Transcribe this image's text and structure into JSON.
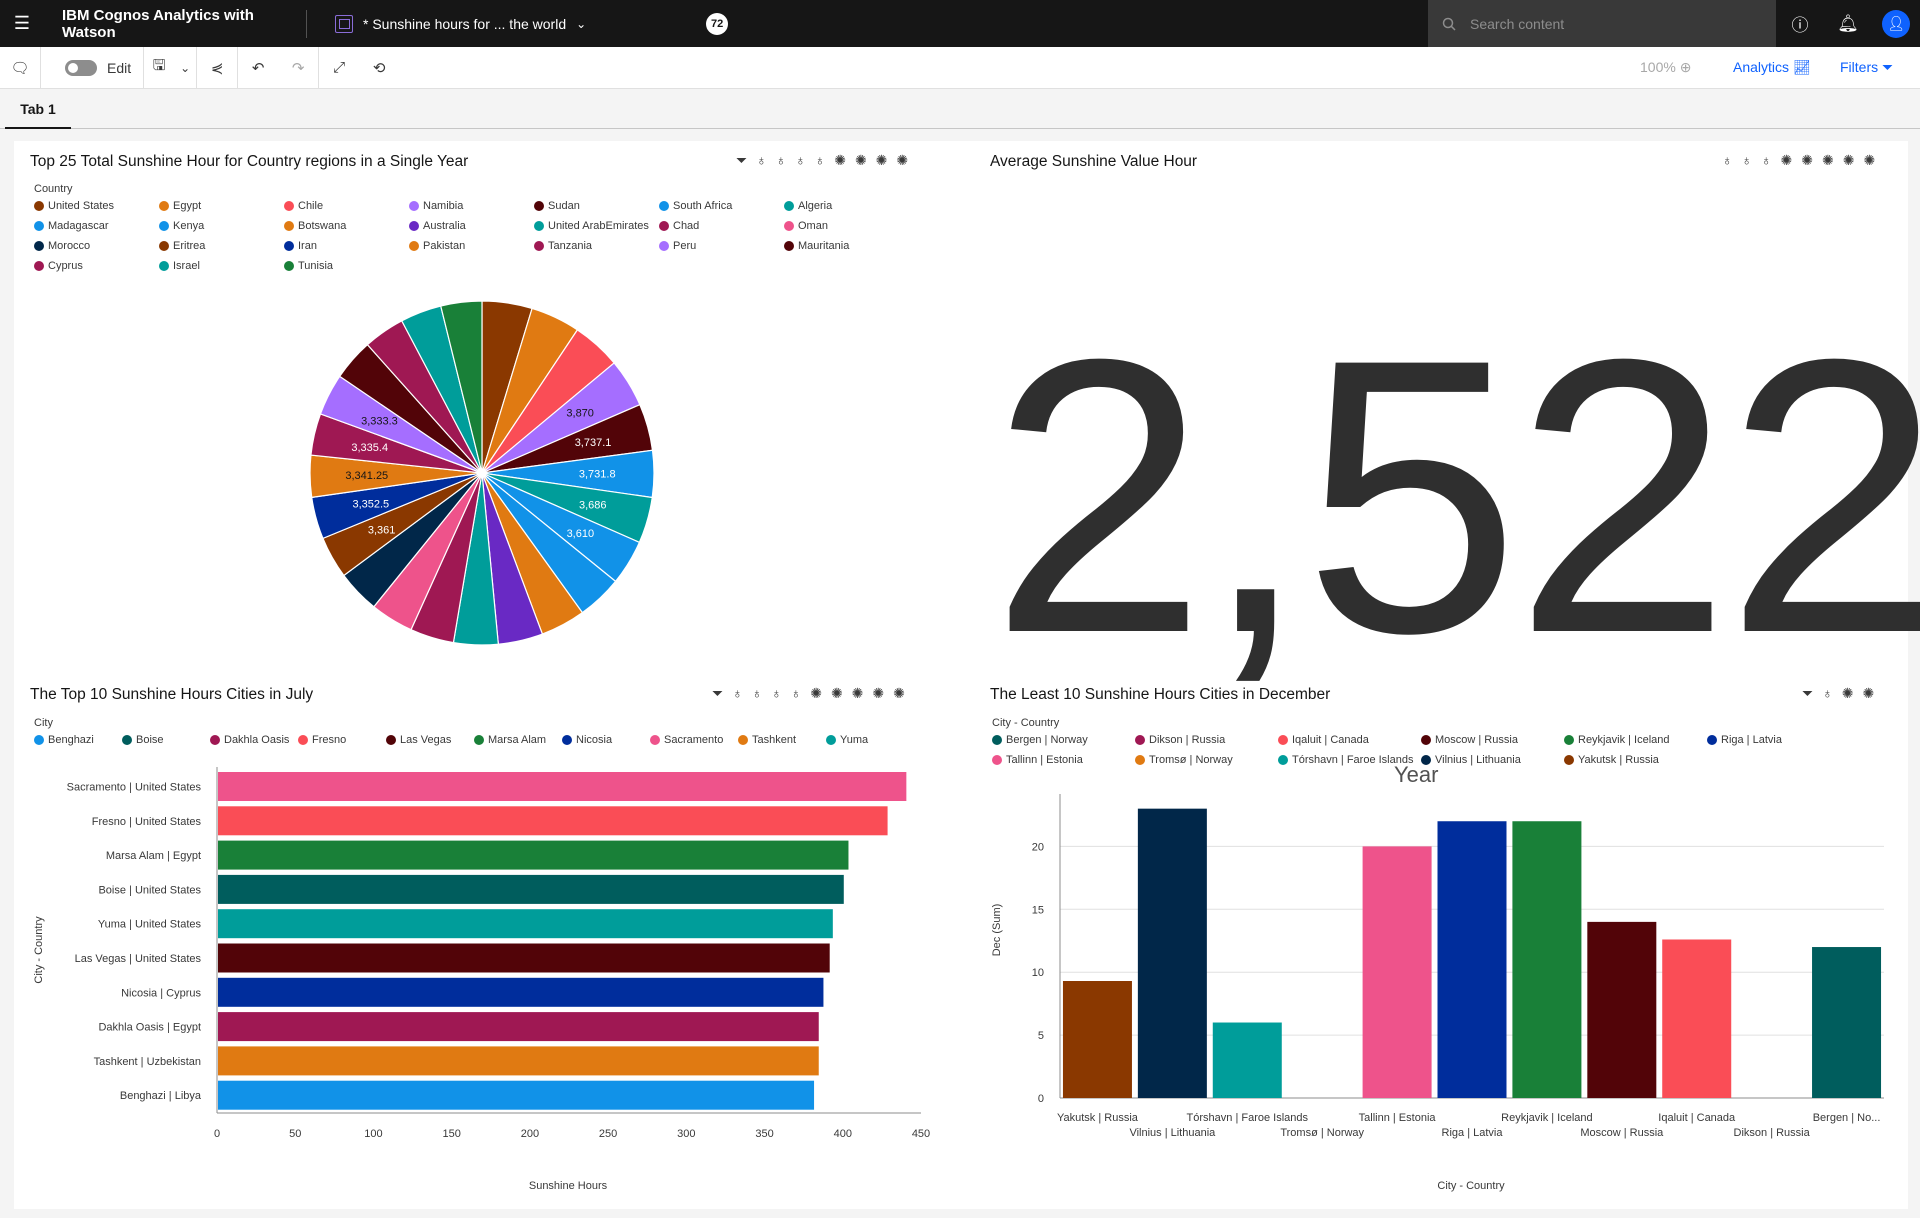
{
  "header": {
    "brand": "IBM Cognos Analytics with Watson",
    "document_title": "* Sunshine hours for ... the world",
    "notification_count": "72",
    "search_placeholder": "Search content"
  },
  "toolbar": {
    "edit_label": "Edit",
    "zoom": "100%",
    "analytics_label": "Analytics",
    "filters_label": "Filters"
  },
  "tabs": [
    {
      "label": "Tab 1"
    }
  ],
  "pie_panel": {
    "title": "Top 25 Total Sunshine Hour for Country regions in a Single Year",
    "legend_title": "Country"
  },
  "kpi_panel": {
    "title": "Average Sunshine Value Hour",
    "value": "2,522",
    "label": "Year"
  },
  "bar_panel": {
    "title": "The Top 10 Sunshine Hours Cities in July",
    "legend_title": "City"
  },
  "col_panel": {
    "title": "The Least 10 Sunshine Hours Cities in December",
    "legend_title": "City - Country"
  },
  "chart_data": [
    {
      "type": "pie",
      "title": "Top 25 Total Sunshine Hour for Country regions in a Single Year",
      "legend_title": "Country",
      "legend": [
        {
          "name": "United States",
          "color": "#8a3800"
        },
        {
          "name": "Egypt",
          "color": "#e07a12"
        },
        {
          "name": "Chile",
          "color": "#fa4d56"
        },
        {
          "name": "Namibia",
          "color": "#a56eff"
        },
        {
          "name": "Sudan",
          "color": "#520408"
        },
        {
          "name": "South Africa",
          "color": "#1192e8"
        },
        {
          "name": "Algeria",
          "color": "#009d9a"
        },
        {
          "name": "Madagascar",
          "color": "#1192e8"
        },
        {
          "name": "Kenya",
          "color": "#1192e8"
        },
        {
          "name": "Botswana",
          "color": "#e07a12"
        },
        {
          "name": "Australia",
          "color": "#6929c4"
        },
        {
          "name": "United ArabEmirates",
          "color": "#009d9a"
        },
        {
          "name": "Chad",
          "color": "#9f1853"
        },
        {
          "name": "Oman",
          "color": "#ee538b"
        },
        {
          "name": "Morocco",
          "color": "#012749"
        },
        {
          "name": "Eritrea",
          "color": "#8a3800"
        },
        {
          "name": "Iran",
          "color": "#002d9c"
        },
        {
          "name": "Pakistan",
          "color": "#e07a12"
        },
        {
          "name": "Tanzania",
          "color": "#9f1853"
        },
        {
          "name": "Peru",
          "color": "#a56eff"
        },
        {
          "name": "Mauritania",
          "color": "#520408"
        },
        {
          "name": "Cyprus",
          "color": "#9f1853"
        },
        {
          "name": "Israel",
          "color": "#009d9a"
        },
        {
          "name": "Tunisia",
          "color": "#198038"
        }
      ],
      "slice_colors": [
        "#8a3800",
        "#e07a12",
        "#fa4d56",
        "#a56eff",
        "#520408",
        "#1192e8",
        "#009d9a",
        "#1192e8",
        "#1192e8",
        "#e07a12",
        "#6929c4",
        "#009d9a",
        "#9f1853",
        "#ee538b",
        "#012749",
        "#8a3800",
        "#002d9c",
        "#e07a12",
        "#9f1853",
        "#a56eff",
        "#520408",
        "#9f1853",
        "#009d9a",
        "#198038"
      ],
      "slice_labels": [
        "",
        "",
        "",
        "3,870",
        "3,737.1",
        "3,731.8",
        "3,686",
        "3,610",
        "",
        "",
        "",
        "",
        "",
        "",
        "",
        "3,361",
        "3,352.5",
        "3,341.25",
        "3,335.4",
        "3,333.3",
        "",
        "",
        "",
        ""
      ],
      "values": [
        4000,
        3960,
        3910,
        3870,
        3737.1,
        3731.8,
        3686,
        3610,
        3600,
        3580,
        3570,
        3550,
        3500,
        3450,
        3420,
        3361,
        3352.5,
        3341.25,
        3335.4,
        3333.3,
        3320,
        3300,
        3290,
        3280
      ]
    },
    {
      "type": "bar",
      "orientation": "horizontal",
      "title": "The Top 10 Sunshine Hours Cities in July",
      "legend_title": "City",
      "legend": [
        {
          "name": "Benghazi",
          "color": "#1192e8"
        },
        {
          "name": "Boise",
          "color": "#005d5d"
        },
        {
          "name": "Dakhla Oasis",
          "color": "#9f1853"
        },
        {
          "name": "Fresno",
          "color": "#fa4d56"
        },
        {
          "name": "Las Vegas",
          "color": "#520408"
        },
        {
          "name": "Marsa Alam",
          "color": "#198038"
        },
        {
          "name": "Nicosia",
          "color": "#002d9c"
        },
        {
          "name": "Sacramento",
          "color": "#ee538b"
        },
        {
          "name": "Tashkent",
          "color": "#e07a12"
        },
        {
          "name": "Yuma",
          "color": "#009d9a"
        }
      ],
      "categories": [
        "Sacramento | United States",
        "Fresno | United States",
        "Marsa Alam | Egypt",
        "Boise | United States",
        "Yuma | United States",
        "Las Vegas | United States",
        "Nicosia | Cyprus",
        "Dakhla Oasis | Egypt",
        "Tashkent | Uzbekistan",
        "Benghazi | Libya"
      ],
      "values": [
        440,
        428,
        403,
        400,
        393,
        391,
        387,
        384,
        384,
        381
      ],
      "colors": [
        "#ee538b",
        "#fa4d56",
        "#198038",
        "#005d5d",
        "#009d9a",
        "#520408",
        "#002d9c",
        "#9f1853",
        "#e07a12",
        "#1192e8"
      ],
      "xlabel": "Sunshine Hours",
      "ylabel": "City - Country",
      "xticks": [
        "0",
        "50",
        "100",
        "150",
        "200",
        "250",
        "300",
        "350",
        "400",
        "450"
      ],
      "xlim": [
        0,
        450
      ]
    },
    {
      "type": "bar",
      "title": "The Least 10 Sunshine Hours Cities in December",
      "legend_title": "City - Country",
      "legend": [
        {
          "name": "Bergen | Norway",
          "color": "#005d5d"
        },
        {
          "name": "Dikson | Russia",
          "color": "#9f1853"
        },
        {
          "name": "Iqaluit | Canada",
          "color": "#fa4d56"
        },
        {
          "name": "Moscow | Russia",
          "color": "#520408"
        },
        {
          "name": "Reykjavik | Iceland",
          "color": "#198038"
        },
        {
          "name": "Riga | Latvia",
          "color": "#002d9c"
        },
        {
          "name": "Tallinn | Estonia",
          "color": "#ee538b"
        },
        {
          "name": "Tromsø | Norway",
          "color": "#e07a12"
        },
        {
          "name": "Tórshavn | Faroe Islands",
          "color": "#009d9a"
        },
        {
          "name": "Vilnius | Lithuania",
          "color": "#012749"
        },
        {
          "name": "Yakutsk | Russia",
          "color": "#8a3800"
        }
      ],
      "categories": [
        "Yakutsk | Russia",
        "Vilnius | Lithuania",
        "Tórshavn | Faroe Islands",
        "Tromsø | Norway",
        "Tallinn | Estonia",
        "Riga | Latvia",
        "Reykjavik | Iceland",
        "Moscow | Russia",
        "Iqaluit | Canada",
        "Dikson | Russia",
        "Bergen | No..."
      ],
      "values": [
        9.3,
        23,
        6,
        0,
        20,
        22,
        22,
        14,
        12.6,
        0,
        12
      ],
      "colors": [
        "#8a3800",
        "#012749",
        "#009d9a",
        "#e07a12",
        "#ee538b",
        "#002d9c",
        "#198038",
        "#520408",
        "#fa4d56",
        "#9f1853",
        "#005d5d"
      ],
      "xlabel": "City - Country",
      "ylabel": "Dec (Sum)",
      "yticks": [
        "0",
        "5",
        "10",
        "15",
        "20"
      ],
      "ylim": [
        0,
        24
      ]
    }
  ]
}
